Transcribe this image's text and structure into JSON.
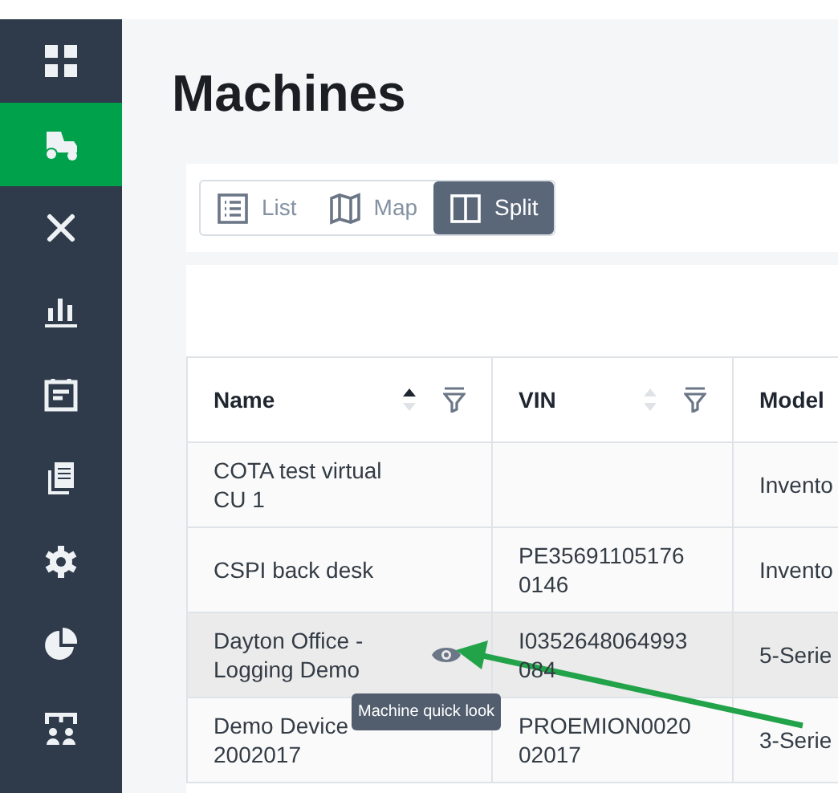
{
  "sidebar": {
    "items": [
      {
        "kind": "grid",
        "selected": false
      },
      {
        "kind": "tractor",
        "selected": true
      },
      {
        "kind": "tools",
        "selected": false
      },
      {
        "kind": "chart",
        "selected": false
      },
      {
        "kind": "calendar",
        "selected": false
      },
      {
        "kind": "documents",
        "selected": false
      },
      {
        "kind": "settings",
        "selected": false
      },
      {
        "kind": "pie",
        "selected": false
      },
      {
        "kind": "org",
        "selected": false
      }
    ]
  },
  "page": {
    "title": "Machines"
  },
  "view_tabs": [
    {
      "kind": "list",
      "label": "List",
      "selected": false
    },
    {
      "kind": "map",
      "label": "Map",
      "selected": false
    },
    {
      "kind": "split",
      "label": "Split",
      "selected": true
    }
  ],
  "table": {
    "columns": [
      {
        "label": "Name",
        "kind": "sortable",
        "sorted_ascending": true
      },
      {
        "label": "VIN",
        "kind": "sortable",
        "sorted_ascending": false
      },
      {
        "label": "Model",
        "kind": "plain"
      }
    ],
    "rows": [
      {
        "name": "COTA test virtual CU 1",
        "vin": "",
        "model": "Invento",
        "hovered": false
      },
      {
        "name": "CSPI back desk",
        "vin": "PE356911051760146",
        "model": "Invento",
        "hovered": false
      },
      {
        "name": "Dayton Office - Logging Demo",
        "vin": "I0352648064993084",
        "model": "5-Serie",
        "hovered": true
      },
      {
        "name": "Demo Device 2002017",
        "vin": "PROEMION002002017",
        "model": "3-Serie",
        "hovered": false
      }
    ]
  },
  "tooltip": {
    "text": "Machine quick look"
  }
}
